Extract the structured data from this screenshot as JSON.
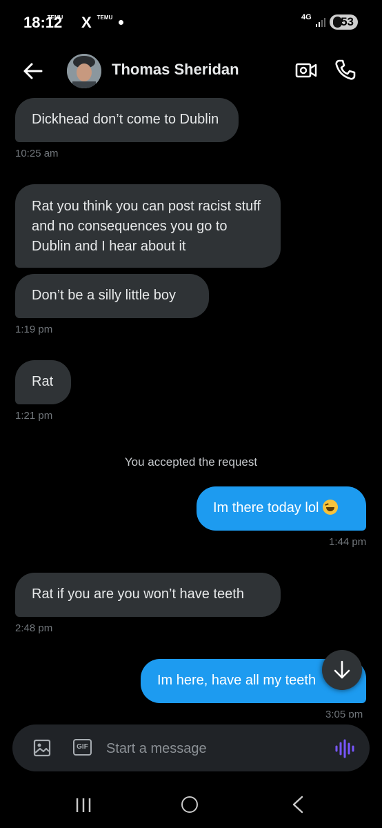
{
  "status_bar": {
    "time": "18:12",
    "notif_app_1": "TEMU",
    "notif_app_2": "TEMU",
    "notif_x": "X",
    "network": "4G",
    "battery": "53"
  },
  "header": {
    "contact_name": "Thomas Sheridan",
    "back_icon": "arrow-left-icon",
    "video_icon": "video-call-icon",
    "call_icon": "phone-icon"
  },
  "messages": [
    {
      "direction": "received",
      "text": "Dickhead don’t come to Dublin",
      "time": "10:25 am"
    },
    {
      "direction": "received",
      "text": "Rat you think you can post racist stuff and no consequences you go to Dublin and I hear about it",
      "time": ""
    },
    {
      "direction": "received",
      "text": "Don’t be a silly little boy",
      "time": "1:19 pm"
    },
    {
      "direction": "received",
      "text": "Rat",
      "time": "1:21 pm"
    },
    {
      "direction": "sent",
      "text": "Im there today lol",
      "time": "1:44 pm",
      "emoji": "grinning-squinting-face"
    },
    {
      "direction": "received",
      "text": "Rat if you are you won’t have teeth",
      "time": "2:48 pm"
    },
    {
      "direction": "sent",
      "text": "Im here, have all my teeth",
      "time": "3:05 pm"
    }
  ],
  "system_message": "You accepted the request",
  "composer": {
    "placeholder": "Start a message",
    "gif_label": "GIF",
    "image_icon": "image-icon",
    "voice_icon": "voice-waveform-icon"
  },
  "colors": {
    "background": "#000000",
    "received_bubble": "#2f3336",
    "sent_bubble": "#1d9bf0",
    "timestamp": "#71767b",
    "voice_accent": "#7856ff"
  }
}
